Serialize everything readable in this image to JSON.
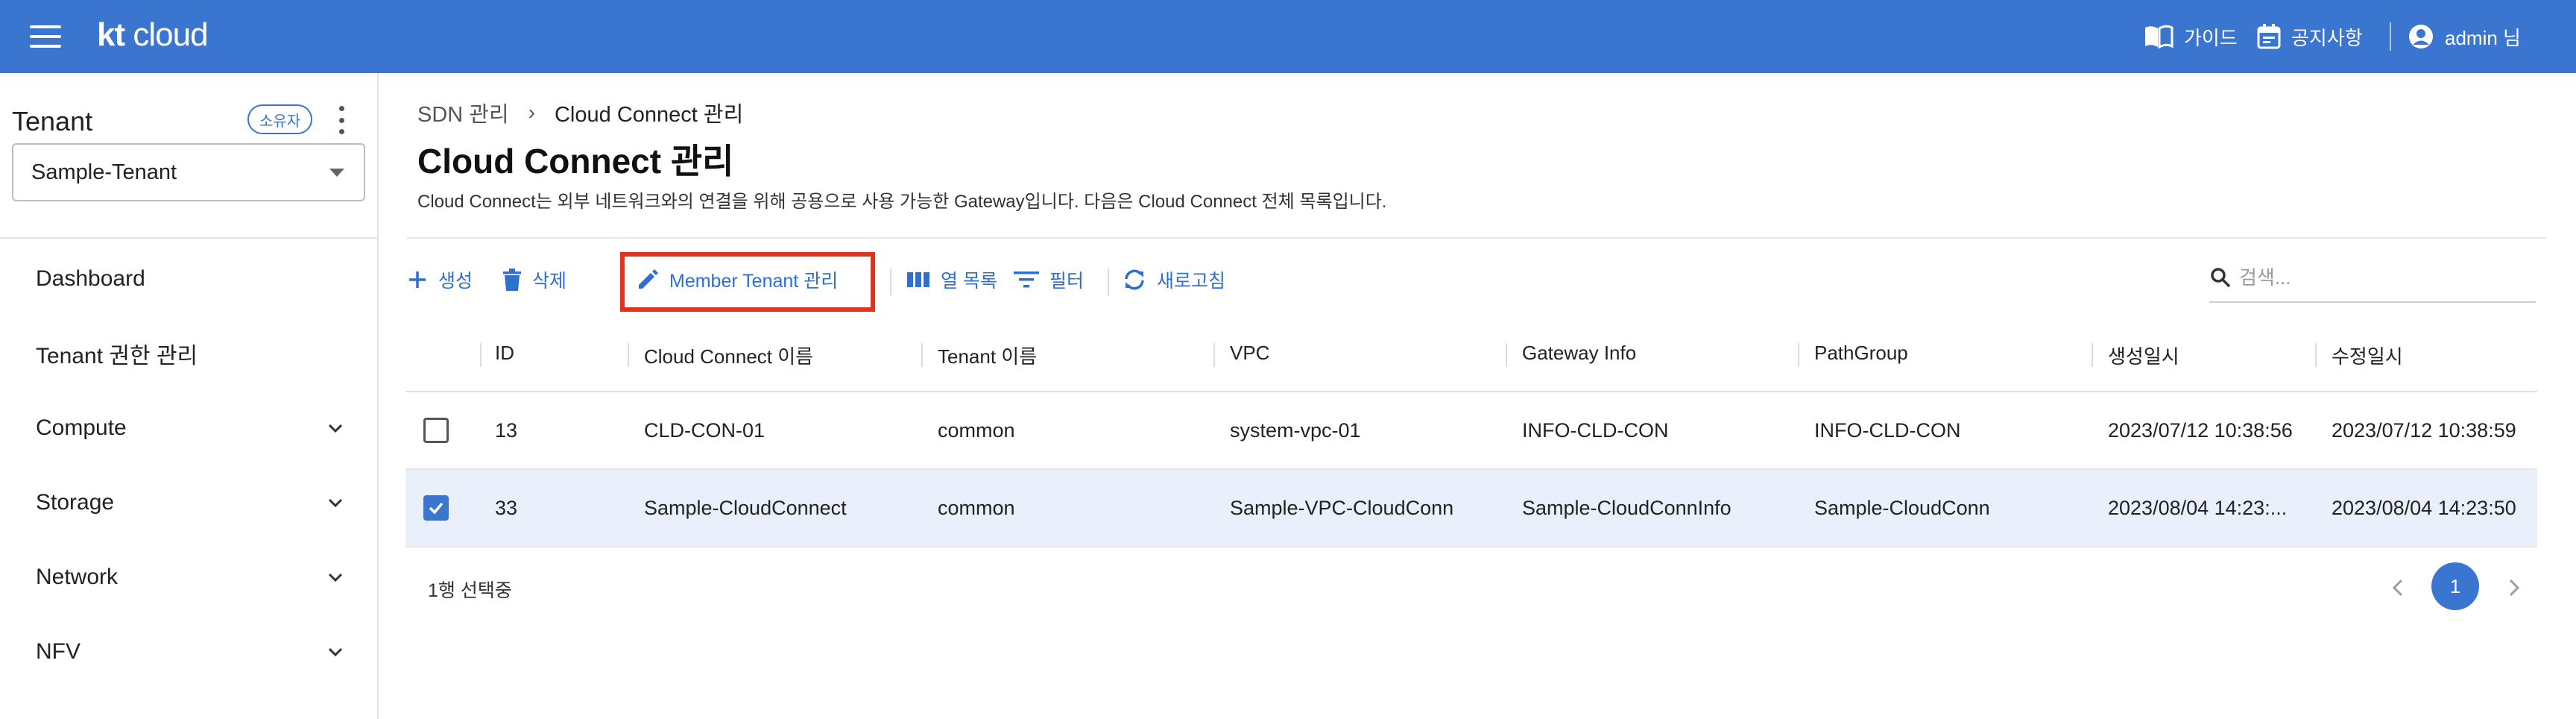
{
  "header": {
    "logo_bold": "kt",
    "logo_rest": "cloud",
    "guide": "가이드",
    "notice": "공지사항",
    "user": "admin 님",
    "colors": {
      "bar": "#3a75cf"
    }
  },
  "sidebar": {
    "title": "Tenant",
    "owner_badge": "소유자",
    "selected_tenant": "Sample-Tenant",
    "items": [
      {
        "label": "Dashboard",
        "expandable": false
      },
      {
        "label": "Tenant 권한 관리",
        "expandable": false
      },
      {
        "label": "Compute",
        "expandable": true
      },
      {
        "label": "Storage",
        "expandable": true
      },
      {
        "label": "Network",
        "expandable": true
      },
      {
        "label": "NFV",
        "expandable": true
      }
    ]
  },
  "main": {
    "breadcrumb": {
      "parent": "SDN 관리",
      "current": "Cloud Connect 관리"
    },
    "title": "Cloud Connect 관리",
    "description": "Cloud Connect는 외부 네트워크와의 연결을 위해 공용으로 사용 가능한 Gateway입니다. 다음은 Cloud Connect 전체 목록입니다.",
    "toolbar": {
      "create": "생성",
      "delete": "삭제",
      "member_tenant": "Member Tenant 관리",
      "columns": "열 목록",
      "filter": "필터",
      "refresh": "새로고침"
    },
    "search_placeholder": "검색...",
    "table": {
      "headers": [
        "ID",
        "Cloud Connect 이름",
        "Tenant 이름",
        "VPC",
        "Gateway Info",
        "PathGroup",
        "생성일시",
        "수정일시"
      ],
      "rows": [
        {
          "selected": false,
          "cells": [
            "13",
            "CLD-CON-01",
            "common",
            "system-vpc-01",
            "INFO-CLD-CON",
            "INFO-CLD-CON",
            "2023/07/12 10:38:56",
            "2023/07/12 10:38:59"
          ]
        },
        {
          "selected": true,
          "cells": [
            "33",
            "Sample-CloudConnect",
            "common",
            "Sample-VPC-CloudConn",
            "Sample-CloudConnInfo",
            "Sample-CloudConn",
            "2023/08/04 14:23:...",
            "2023/08/04 14:23:50"
          ]
        }
      ]
    },
    "selection_status": "1행 선택중",
    "pagination": {
      "current_page": "1"
    },
    "accent_color": "#2f6fce",
    "highlight_color": "#e0321f"
  }
}
